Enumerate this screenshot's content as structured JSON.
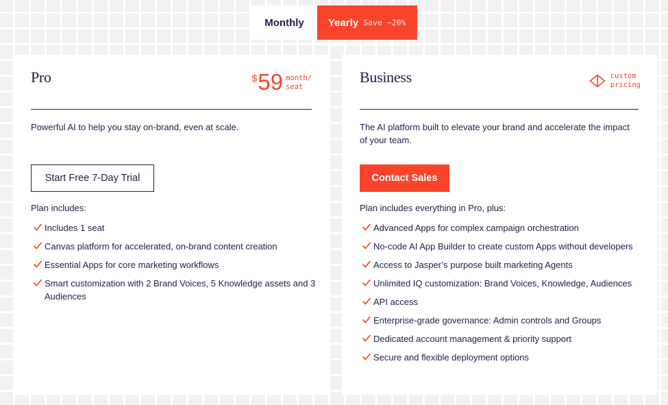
{
  "billing_toggle": {
    "monthly_label": "Monthly",
    "yearly_label": "Yearly",
    "yearly_badge": "Save ~20%",
    "selected": "Yearly"
  },
  "colors": {
    "accent": "#f8442b",
    "navy": "#1c1e4a",
    "background": "#f1f1f1"
  },
  "plans": [
    {
      "name": "Pro",
      "price": {
        "currency": "$",
        "amount": "59",
        "unit_line1": "month/",
        "unit_line2": "seat"
      },
      "description": "Powerful AI to help you stay on-brand, even at scale.",
      "cta_label": "Start Free 7-Day Trial",
      "includes_title": "Plan includes:",
      "features": [
        "Includes 1 seat",
        "Canvas platform for accelerated, on-brand content creation",
        "Essential Apps for core marketing workflows",
        "Smart customization with 2 Brand Voices, 5 Knowledge assets and 3 Audiences"
      ]
    },
    {
      "name": "Business",
      "pricing_icon": "diamond-icon",
      "pricing_line1": "custom",
      "pricing_line2": "pricing",
      "description": "The AI platform built to elevate your brand and accelerate the impact of your team.",
      "cta_label": "Contact Sales",
      "includes_title": "Plan includes everything in Pro, plus:",
      "features": [
        "Advanced Apps for complex campaign orchestration",
        "No-code AI App Builder to create custom Apps without developers",
        "Access to Jasper’s purpose built marketing Agents",
        "Unlimited IQ customization: Brand Voices, Knowledge, Audiences",
        "API access",
        "Enterprise-grade governance: Admin controls and Groups",
        "Dedicated account management & priority support",
        "Secure and flexible deployment options"
      ]
    }
  ]
}
